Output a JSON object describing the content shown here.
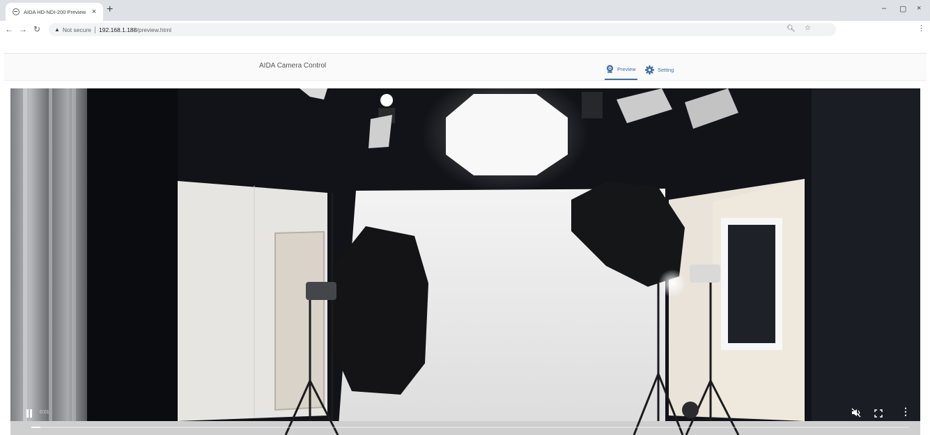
{
  "browser": {
    "tab_title": "AIDA HD-NDI-200 Preview",
    "tab_close": "×",
    "new_tab": "+",
    "security_label": "Not secure",
    "url_host": "192.168.1.188",
    "url_path": "/preview.html",
    "window_controls": {
      "minimize": "–",
      "maximize": "▢",
      "close": "×"
    },
    "icons": [
      "back-arrow-icon",
      "forward-arrow-icon",
      "reload-icon",
      "warning-icon",
      "zoom-icon",
      "star-icon",
      "menu-icon"
    ]
  },
  "app": {
    "title": "AIDA Camera Control",
    "nav": [
      {
        "label": "Preview",
        "icon": "webcam-icon",
        "active": true
      },
      {
        "label": "Setting",
        "icon": "gear-icon",
        "active": false
      }
    ],
    "accent_color": "#3f6fa8"
  },
  "video": {
    "timecode": "0:01",
    "progress": 0.01,
    "playing": true,
    "controls": [
      "pause-icon",
      "mute-icon",
      "fullscreen-icon",
      "more-options-icon"
    ]
  }
}
